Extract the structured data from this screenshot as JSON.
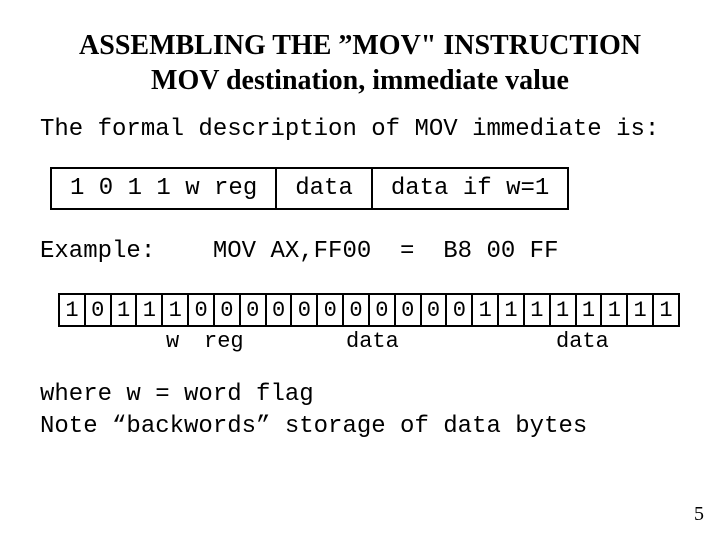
{
  "title_line1": "ASSEMBLING THE ”MOV\" INSTRUCTION",
  "title_line2": "MOV destination, immediate value",
  "intro": "The formal description of MOV immediate is:",
  "format_cells": {
    "c0": "1 0 1 1 w reg",
    "c1": "data",
    "c2": "data if w=1"
  },
  "example_line": "Example:    MOV AX,FF00  =  B8 00 FF",
  "bits": [
    "1",
    "0",
    "1",
    "1",
    "1",
    "0",
    "0",
    "0",
    "0",
    "0",
    "0",
    "0",
    "0",
    "0",
    "0",
    "0",
    "1",
    "1",
    "1",
    "1",
    "1",
    "1",
    "1",
    "1"
  ],
  "bit_labels": {
    "w": "w",
    "reg": "reg",
    "data1": "data",
    "data2": "data"
  },
  "notes_line1": "where w = word flag",
  "notes_line2": "Note “backwords” storage of data bytes",
  "page_number": "5"
}
